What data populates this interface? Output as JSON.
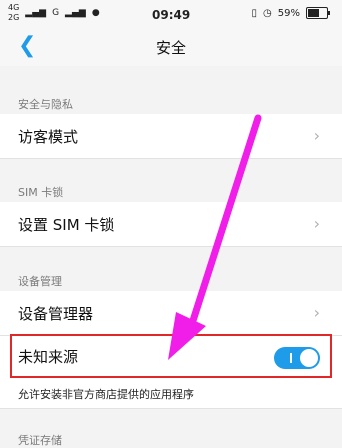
{
  "status_bar": {
    "network_top": "4G",
    "network_bottom": "2G",
    "signal2": "G",
    "time": "09:49",
    "battery_percent_text": "59%",
    "battery_level": 0.59
  },
  "header": {
    "back_icon": "chevron-left-icon",
    "title": "安全"
  },
  "sections": {
    "security_privacy": {
      "label": "安全与隐私",
      "item_label": "访客模式"
    },
    "sim_lock": {
      "label": "SIM 卡锁",
      "item_label": "设置 SIM 卡锁"
    },
    "device_management": {
      "label": "设备管理",
      "manager_label": "设备管理器",
      "unknown_sources_label": "未知来源",
      "unknown_sources_enabled": true,
      "unknown_sources_desc": "允许安装非官方商店提供的应用程序"
    },
    "credential_storage": {
      "label": "凭证存储"
    }
  },
  "annotations": {
    "arrow_color": "#f01ee8",
    "highlight_color": "#e02828"
  },
  "colors": {
    "accent": "#1e9be9",
    "background": "#f3f3f3"
  }
}
